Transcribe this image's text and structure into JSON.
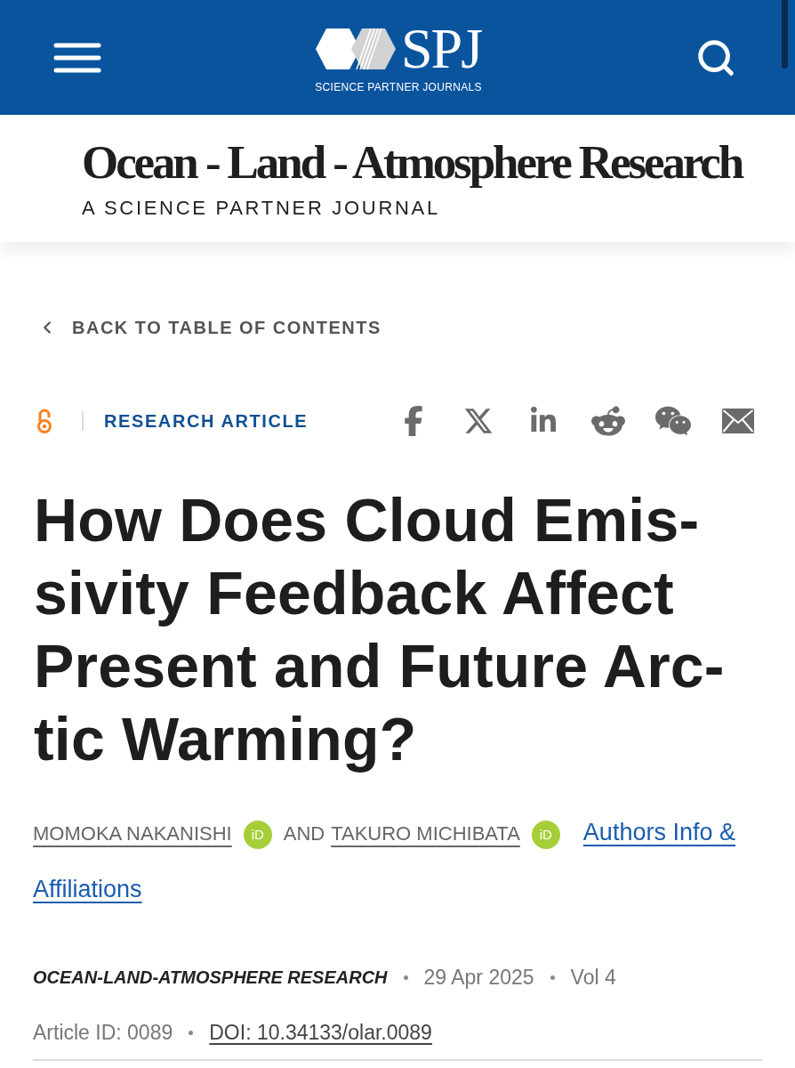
{
  "header": {
    "logo_mark": "SPJ",
    "logo_caption": "SCIENCE PARTNER JOURNALS"
  },
  "journal": {
    "title": "Ocean - Land - Atmosphere Research",
    "subtitle": "A SCIENCE PARTNER JOURNAL"
  },
  "back_link": {
    "label": "BACK TO TABLE OF CONTENTS"
  },
  "article_type": {
    "open_access": true,
    "label": "RESEARCH ARTICLE"
  },
  "share": [
    {
      "kind": "facebook"
    },
    {
      "kind": "x"
    },
    {
      "kind": "linkedin"
    },
    {
      "kind": "reddit"
    },
    {
      "kind": "wechat"
    },
    {
      "kind": "email"
    }
  ],
  "title": "How Does Cloud Emis-sivity Feedback Affect Present and Future Arc-tic Warming?",
  "authors": [
    {
      "name": "MOMOKA NAKANISHI",
      "orcid_badge": "iD"
    },
    {
      "name": "TAKURO MICHIBATA",
      "orcid_badge": "iD"
    }
  ],
  "author_conjunction": "AND",
  "authors_info_link": [
    "Authors Info &",
    "Affiliations"
  ],
  "meta": {
    "journal": "OCEAN-LAND-ATMOSPHERE RESEARCH",
    "date": "29 Apr 2025",
    "volume": "Vol 4",
    "article_id": "Article ID: 0089",
    "doi": "DOI: 10.34133/olar.0089"
  }
}
